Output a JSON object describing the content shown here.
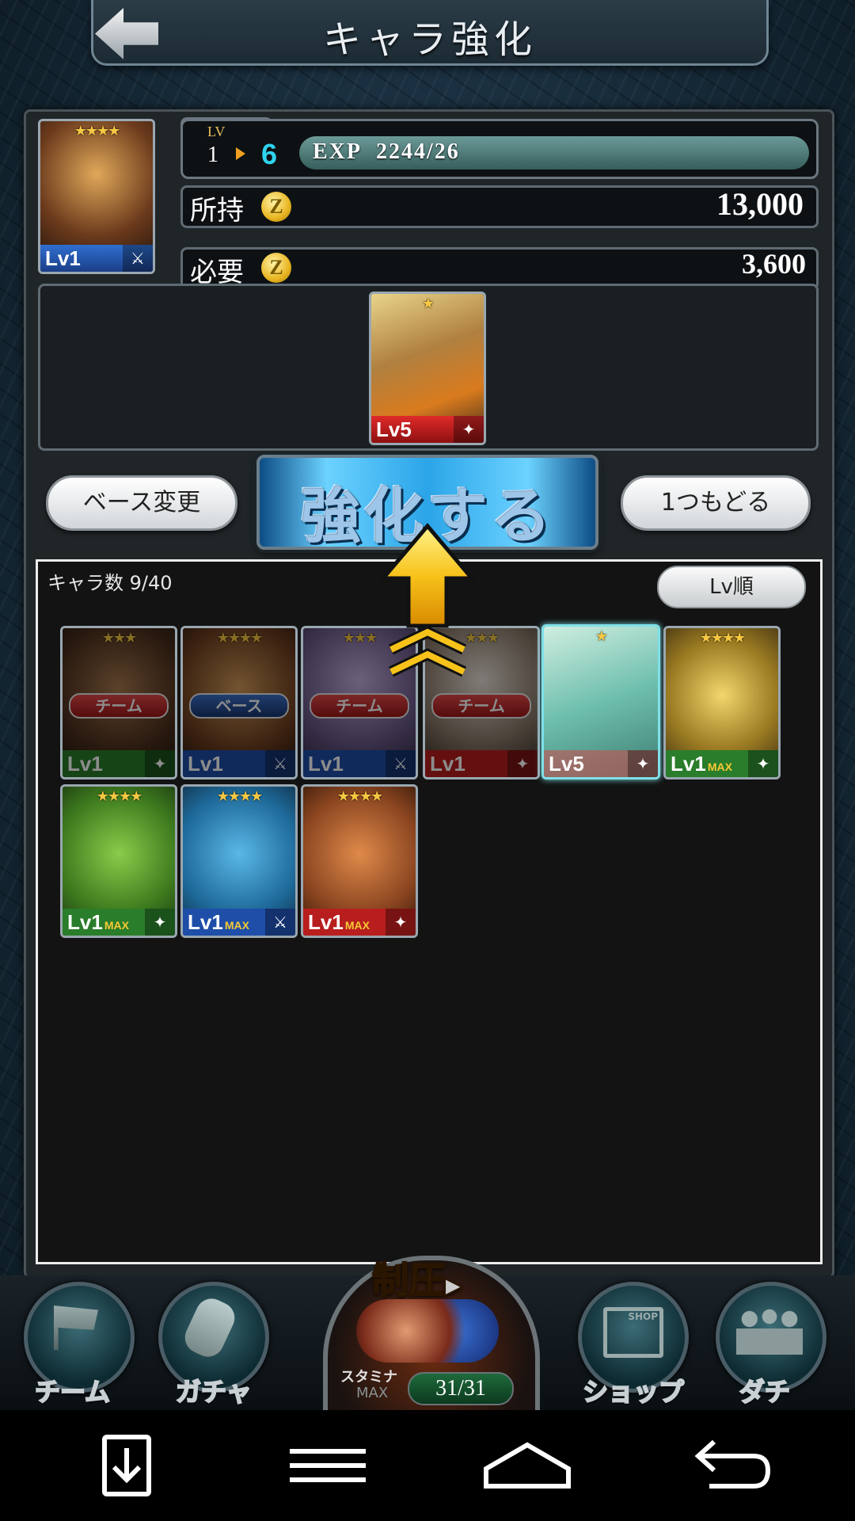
{
  "header": {
    "title": "キャラ強化"
  },
  "base_card": {
    "stars": "★★★★",
    "level": "Lv1"
  },
  "level": {
    "label": "LV",
    "from": "1",
    "to": "6",
    "exp_label": "EXP",
    "exp_value": "2244/26"
  },
  "owned": {
    "label": "所持",
    "value": "13,000",
    "coin": "Z"
  },
  "required": {
    "label": "必要",
    "value": "3,600",
    "coin": "Z"
  },
  "material_card": {
    "stars": "★",
    "level": "Lv5"
  },
  "buttons": {
    "change_base": "ベース変更",
    "enhance": "強化する",
    "undo": "1つもどる"
  },
  "list": {
    "count": "キャラ数 9/40",
    "sort": "Lv順"
  },
  "cards": [
    {
      "stars": "★★★",
      "tag": "チーム",
      "level": "Lv1",
      "max": ""
    },
    {
      "stars": "★★★★",
      "tag": "ベース",
      "level": "Lv1",
      "max": ""
    },
    {
      "stars": "★★★",
      "tag": "チーム",
      "level": "Lv1",
      "max": ""
    },
    {
      "stars": "★★★",
      "tag": "チーム",
      "level": "Lv1",
      "max": ""
    },
    {
      "stars": "★",
      "tag": "",
      "level": "Lv5",
      "max": ""
    },
    {
      "stars": "★★★★",
      "tag": "",
      "level": "Lv1",
      "max": "MAX"
    },
    {
      "stars": "★★★★",
      "tag": "",
      "level": "Lv1",
      "max": "MAX"
    },
    {
      "stars": "★★★★",
      "tag": "",
      "level": "Lv1",
      "max": "MAX"
    },
    {
      "stars": "★★★★",
      "tag": "",
      "level": "Lv1",
      "max": "MAX"
    }
  ],
  "bottom_nav": {
    "team": "チーム",
    "gacha": "ガチャ",
    "center": "制圧",
    "stamina_label": "スタミナ",
    "stamina_max": "MAX",
    "stamina_value": "31/31",
    "shop": "ショップ",
    "shop_sign": "SHOP",
    "friends": "ダチ"
  }
}
